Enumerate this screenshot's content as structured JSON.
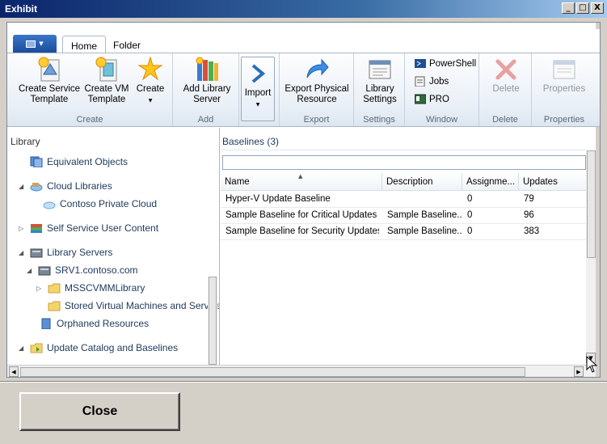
{
  "window": {
    "title": "Exhibit",
    "minimize": "_",
    "maximize": "□",
    "close": "X"
  },
  "ribbon": {
    "tabs": [
      {
        "label": "Home"
      },
      {
        "label": "Folder"
      }
    ],
    "groups": {
      "create": {
        "label": "Create",
        "create_service_template": "Create Service\nTemplate",
        "create_vm_template": "Create VM\nTemplate",
        "create": "Create"
      },
      "add": {
        "label": "Add",
        "add_library_server": "Add Library\nServer"
      },
      "import": {
        "import": "Import"
      },
      "export": {
        "label": "Export",
        "export_physical_resource": "Export Physical\nResource"
      },
      "settings": {
        "label": "Settings",
        "library_settings": "Library\nSettings"
      },
      "window": {
        "label": "Window",
        "powershell": "PowerShell",
        "jobs": "Jobs",
        "pro": "PRO"
      },
      "delete": {
        "label": "Delete",
        "delete": "Delete"
      },
      "properties": {
        "label": "Properties",
        "properties": "Properties"
      }
    }
  },
  "nav": {
    "header": "Library",
    "items": [
      {
        "label": "Equivalent Objects"
      },
      {
        "label": "Cloud Libraries"
      },
      {
        "label": "Contoso Private Cloud"
      },
      {
        "label": "Self Service User Content"
      },
      {
        "label": "Library Servers"
      },
      {
        "label": "SRV1.contoso.com"
      },
      {
        "label": "MSSCVMMLibrary"
      },
      {
        "label": "Stored Virtual Machines and Services"
      },
      {
        "label": "Orphaned Resources"
      },
      {
        "label": "Update Catalog and Baselines"
      }
    ]
  },
  "content": {
    "title": "Baselines (3)",
    "columns": [
      "Name",
      "Description",
      "Assignme...",
      "Updates"
    ],
    "rows": [
      {
        "name": "Hyper-V Update Baseline",
        "description": "",
        "assignments": "0",
        "updates": "79"
      },
      {
        "name": "Sample Baseline for Critical Updates",
        "description": "Sample Baseline...",
        "assignments": "0",
        "updates": "96"
      },
      {
        "name": "Sample Baseline for Security Updates",
        "description": "Sample Baseline...",
        "assignments": "0",
        "updates": "383"
      }
    ]
  },
  "footer": {
    "close_label": "Close"
  }
}
